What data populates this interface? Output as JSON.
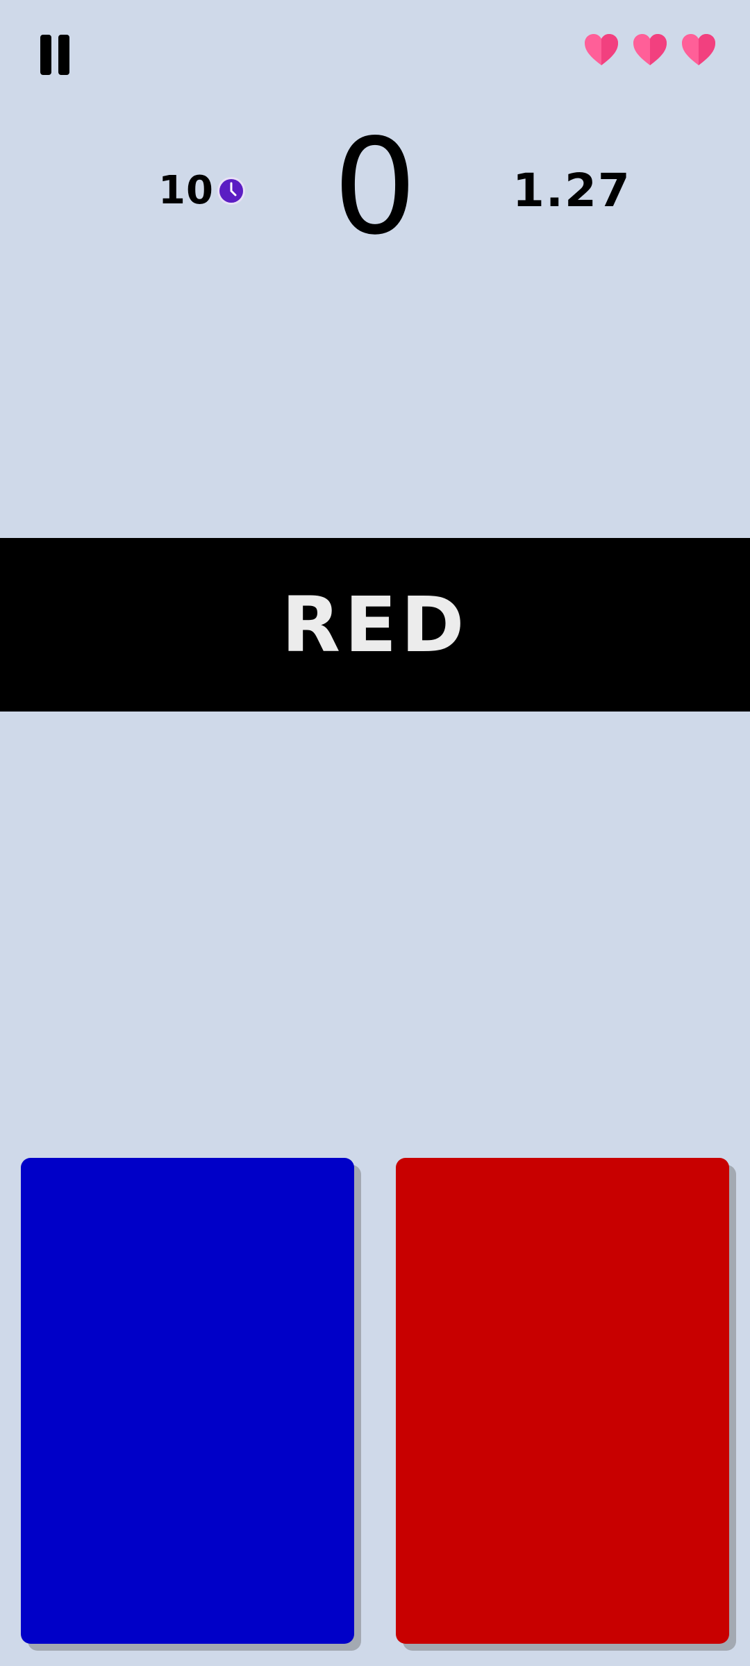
{
  "hud": {
    "timer_value": "10",
    "score": "0",
    "multiplier": "1.27",
    "lives": 3,
    "heart_color": "#ff5f98",
    "clock_color": "#6a1fc9"
  },
  "word": {
    "text": "RED",
    "band_color": "#000000",
    "text_color": "#ececec"
  },
  "choices": [
    {
      "name": "blue",
      "color": "#0000c8"
    },
    {
      "name": "red",
      "color": "#c80000"
    }
  ],
  "icons": {
    "pause": "pause-icon",
    "heart": "heart-icon",
    "clock": "clock-icon"
  },
  "background_color": "#cfd9e9"
}
